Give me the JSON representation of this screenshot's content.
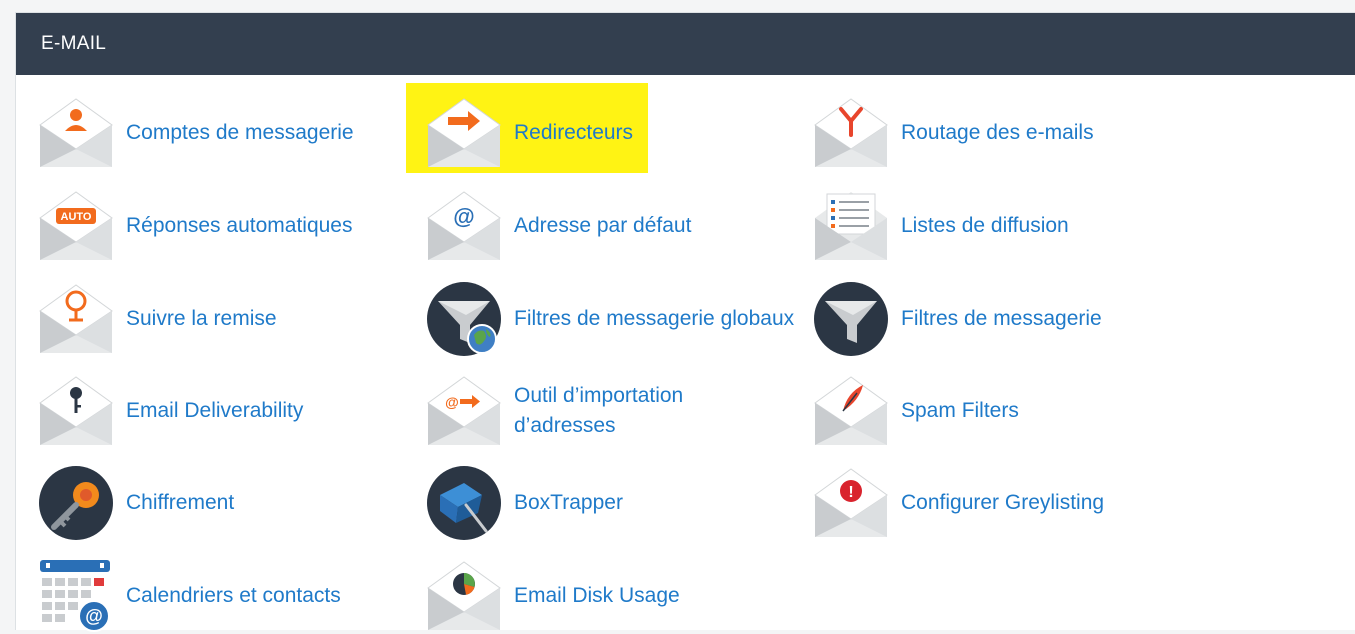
{
  "panel": {
    "title": "E-MAIL"
  },
  "colors": {
    "header_bg": "#333f4f",
    "link": "#1f7ac9",
    "highlight": "#fff200",
    "accent_orange": "#f26b1d"
  },
  "items": {
    "comptes": {
      "label": "Comptes de messagerie",
      "icon": "envelope-user-icon"
    },
    "redirecteurs": {
      "label": "Redirecteurs",
      "icon": "envelope-forward-arrow-icon",
      "highlighted": true
    },
    "routage": {
      "label": "Routage des e-mails",
      "icon": "envelope-routing-icon"
    },
    "reponses": {
      "label": "Réponses automatiques",
      "icon": "envelope-auto-icon",
      "badge": "AUTO"
    },
    "adresse": {
      "label": "Adresse par défaut",
      "icon": "envelope-at-icon",
      "badge": "@"
    },
    "listes": {
      "label": "Listes de diffusion",
      "icon": "envelope-list-icon"
    },
    "suivre": {
      "label": "Suivre la remise",
      "icon": "envelope-location-pin-icon"
    },
    "filtres_globaux": {
      "label": "Filtres de messagerie globaux",
      "icon": "funnel-globe-icon"
    },
    "filtres": {
      "label": "Filtres de messagerie",
      "icon": "funnel-icon"
    },
    "deliverability": {
      "label": "Email Deliverability",
      "icon": "envelope-key-icon"
    },
    "import": {
      "label": "Outil d’importation d’adresses",
      "icon": "envelope-at-arrow-icon",
      "badge": "@"
    },
    "spam": {
      "label": "Spam Filters",
      "icon": "envelope-quill-icon"
    },
    "chiffrement": {
      "label": "Chiffrement",
      "icon": "key-circle-icon"
    },
    "boxtrapper": {
      "label": "BoxTrapper",
      "icon": "box-trap-icon"
    },
    "greylisting": {
      "label": "Configurer Greylisting",
      "icon": "envelope-alert-icon",
      "badge": "!"
    },
    "calendriers": {
      "label": "Calendriers et contacts",
      "icon": "calendar-at-icon",
      "badge": "@"
    },
    "disk": {
      "label": "Email Disk Usage",
      "icon": "envelope-pie-chart-icon"
    }
  }
}
